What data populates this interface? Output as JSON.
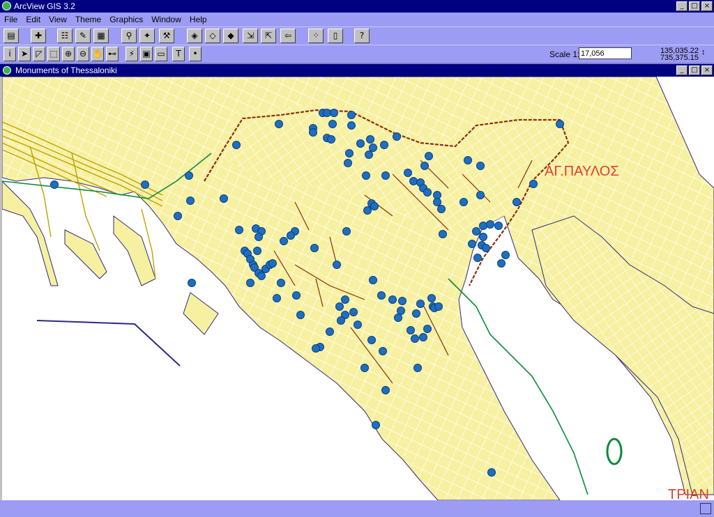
{
  "app": {
    "title": "ArcView GIS 3.2"
  },
  "menu": [
    "File",
    "Edit",
    "View",
    "Theme",
    "Graphics",
    "Window",
    "Help"
  ],
  "view": {
    "title": "Monuments of Thessaloniki"
  },
  "scale": {
    "label": "Scale 1:",
    "value": "17,056"
  },
  "coordinates": {
    "x": "135,035.22",
    "y": "735,375.15"
  },
  "map": {
    "labels": {
      "district_1": "ΑΓ.ΠΑΥΛΟΣ",
      "district_2": "ΤΡΙΑΝ"
    },
    "colors": {
      "land": "#f7f0a0",
      "water": "#ffffff",
      "monument": "#1f6fc0",
      "roads": "#ffffff",
      "walls": "#8b2e10",
      "rail": "#c0a000",
      "boundary": "#0a8a3a"
    }
  }
}
